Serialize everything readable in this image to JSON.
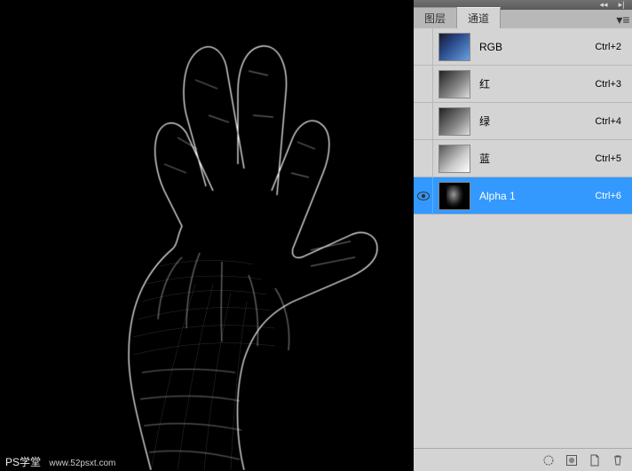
{
  "tabs": {
    "layers": "图层",
    "channels": "通道"
  },
  "channels": [
    {
      "name": "RGB",
      "shortcut": "Ctrl+2",
      "visible": false,
      "selected": false,
      "thumb": "rgb"
    },
    {
      "name": "红",
      "shortcut": "Ctrl+3",
      "visible": false,
      "selected": false,
      "thumb": "red"
    },
    {
      "name": "绿",
      "shortcut": "Ctrl+4",
      "visible": false,
      "selected": false,
      "thumb": "green"
    },
    {
      "name": "蓝",
      "shortcut": "Ctrl+5",
      "visible": false,
      "selected": false,
      "thumb": "blue"
    },
    {
      "name": "Alpha 1",
      "shortcut": "Ctrl+6",
      "visible": true,
      "selected": true,
      "thumb": "alpha"
    }
  ],
  "watermark": {
    "title": "PS学堂",
    "url": "www.52psxt.com"
  }
}
